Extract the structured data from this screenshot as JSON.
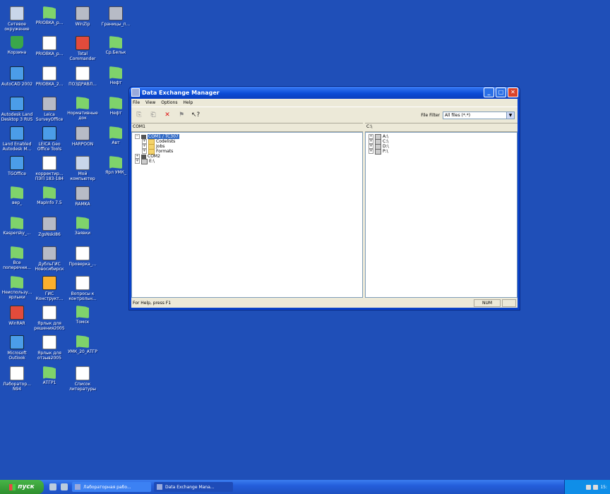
{
  "desktop_icons": [
    {
      "label": "Сетевое окружение",
      "type": "computer"
    },
    {
      "label": "PRIOBKA_p...",
      "type": "folder"
    },
    {
      "label": "WinZip",
      "type": "gray"
    },
    {
      "label": "Границы_п...",
      "type": "gray"
    },
    {
      "label": "Корзина",
      "type": "trash"
    },
    {
      "label": "PRIOBKA_p...",
      "type": "doc"
    },
    {
      "label": "Total Commander",
      "type": "app"
    },
    {
      "label": "Ср.Бельк",
      "type": "folder"
    },
    {
      "label": "AutoCAD 2002",
      "type": "app3"
    },
    {
      "label": "PRIOBKA_2...",
      "type": "doc"
    },
    {
      "label": "ПОЗДРАВЛ...",
      "type": "doc"
    },
    {
      "label": "Нефт",
      "type": "folder"
    },
    {
      "label": "Autodesk Land Desktop 3 RUS",
      "type": "app3"
    },
    {
      "label": "Leica SurveyOffice",
      "type": "gray"
    },
    {
      "label": "Нормативные док",
      "type": "folder"
    },
    {
      "label": "Нефт",
      "type": "folder"
    },
    {
      "label": "Land Enabled Autodesk M...",
      "type": "app3"
    },
    {
      "label": "LEICA Geo Office Tools",
      "type": "app3"
    },
    {
      "label": "HARPOON",
      "type": "gray"
    },
    {
      "label": "Авт",
      "type": "folder"
    },
    {
      "label": "TGOffice",
      "type": "app3"
    },
    {
      "label": "корректир... ПЭП 183-184",
      "type": "doc"
    },
    {
      "label": "Мой компьютер",
      "type": "computer"
    },
    {
      "label": "Ярл УМК_",
      "type": "folder"
    },
    {
      "label": "вер_",
      "type": "folder"
    },
    {
      "label": "MapInfo 7.5",
      "type": "folder"
    },
    {
      "label": "RAMKA",
      "type": "gray"
    },
    {
      "label": "Kaspersky_...",
      "type": "folder"
    },
    {
      "label": "ZgsNskI86",
      "type": "gray"
    },
    {
      "label": "Заявки",
      "type": "folder"
    },
    {
      "label": "Все поперечни...",
      "type": "folder"
    },
    {
      "label": "ДубльГИС Новосибирск",
      "type": "gray"
    },
    {
      "label": "Проверка_...",
      "type": "doc"
    },
    {
      "label": "Неиспользу... ярлыки",
      "type": "folder"
    },
    {
      "label": "ГИС Конструкт...",
      "type": "app2"
    },
    {
      "label": "Вопросы к контрольн...",
      "type": "doc"
    },
    {
      "label": "WinRAR",
      "type": "app"
    },
    {
      "label": "Ярлык для решения2005",
      "type": "doc"
    },
    {
      "label": "Томск",
      "type": "folder"
    },
    {
      "label": "Microsoft Outlook",
      "type": "app3"
    },
    {
      "label": "Ярлык для отзыв2005",
      "type": "doc"
    },
    {
      "label": "УМК_20_АТГР",
      "type": "folder"
    },
    {
      "label": "Лаборатор... N94",
      "type": "doc"
    },
    {
      "label": "АТГР1",
      "type": "folder"
    },
    {
      "label": "Список литературы",
      "type": "doc"
    }
  ],
  "window": {
    "title": "Data Exchange Manager",
    "menu": [
      "File",
      "View",
      "Options",
      "Help"
    ],
    "toolbar_icons": [
      "copy-icon",
      "paste-icon",
      "delete-icon",
      "new-folder-icon",
      "help-pointer-icon"
    ],
    "file_filter_label": "File Filter",
    "file_filter_value": "All files (*.*)",
    "left_header": "COM1",
    "right_header": "C:\\",
    "left_tree": [
      {
        "label": "COM1 / TC307",
        "level": 1,
        "pm": "−",
        "icon": "port",
        "selected": true
      },
      {
        "label": "Codelists",
        "level": 2,
        "pm": "+",
        "icon": "fold",
        "selected": false
      },
      {
        "label": "Jobs",
        "level": 2,
        "pm": "+",
        "icon": "fold",
        "selected": false
      },
      {
        "label": "Formats",
        "level": 2,
        "pm": "+",
        "icon": "fold",
        "selected": false
      },
      {
        "label": "COM2",
        "level": 1,
        "pm": "+",
        "icon": "port",
        "selected": false
      },
      {
        "label": "E:\\",
        "level": 1,
        "pm": "+",
        "icon": "drive",
        "selected": false
      }
    ],
    "right_tree": [
      {
        "label": "A:\\",
        "level": 1,
        "pm": "+",
        "icon": "drive",
        "selected": false
      },
      {
        "label": "C:\\",
        "level": 1,
        "pm": "+",
        "icon": "drive",
        "selected": false
      },
      {
        "label": "D:\\",
        "level": 1,
        "pm": "+",
        "icon": "drive",
        "selected": false
      },
      {
        "label": "P:\\",
        "level": 1,
        "pm": "+",
        "icon": "drive",
        "selected": false
      }
    ],
    "status": "For Help, press F1",
    "status_num": "NUM"
  },
  "taskbar": {
    "start_label": "пуск",
    "tasks": [
      {
        "label": "Лабораторная рабо...",
        "active": false
      },
      {
        "label": "Data Exchange Mana...",
        "active": true
      }
    ],
    "tray_text": "15:"
  }
}
